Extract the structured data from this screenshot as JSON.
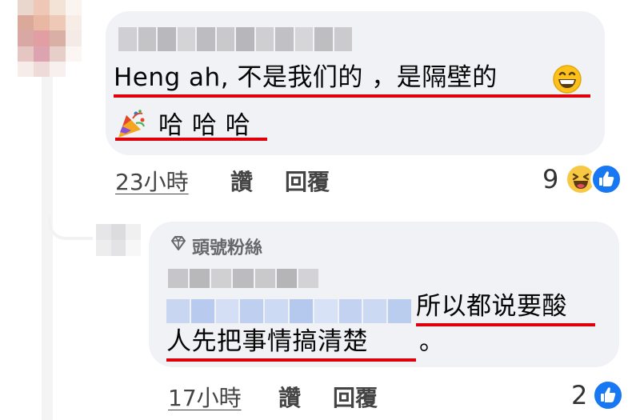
{
  "comment": {
    "author": "",
    "text_line1": "Heng ah, 不是我们的 ，是隔壁的",
    "text_line1_emoji": "grinning-face-icon",
    "text_line2_emoji": "party-popper-icon",
    "text_line2": "哈 哈 哈",
    "timestamp": "23小時",
    "like_label": "讚",
    "reply_label": "回覆",
    "reaction_count": "9",
    "reactions": [
      "laughing-face-icon",
      "like-thumb-icon"
    ]
  },
  "reply": {
    "badge_icon": "diamond-icon",
    "badge_label": "頭號粉絲",
    "author": "",
    "text_line1": "所以都说要酸",
    "text_line2": "人先把事情搞清楚",
    "text_line2_punct": "。",
    "timestamp": "17小時",
    "like_label": "讚",
    "reply_label": "回覆",
    "reaction_count": "2",
    "reactions": [
      "like-thumb-icon"
    ]
  },
  "colors": {
    "bubble_bg": "#f0f2f5",
    "underline_red": "#e0000c",
    "like_blue": "#1877f2",
    "meta_gray": "#65676b"
  }
}
